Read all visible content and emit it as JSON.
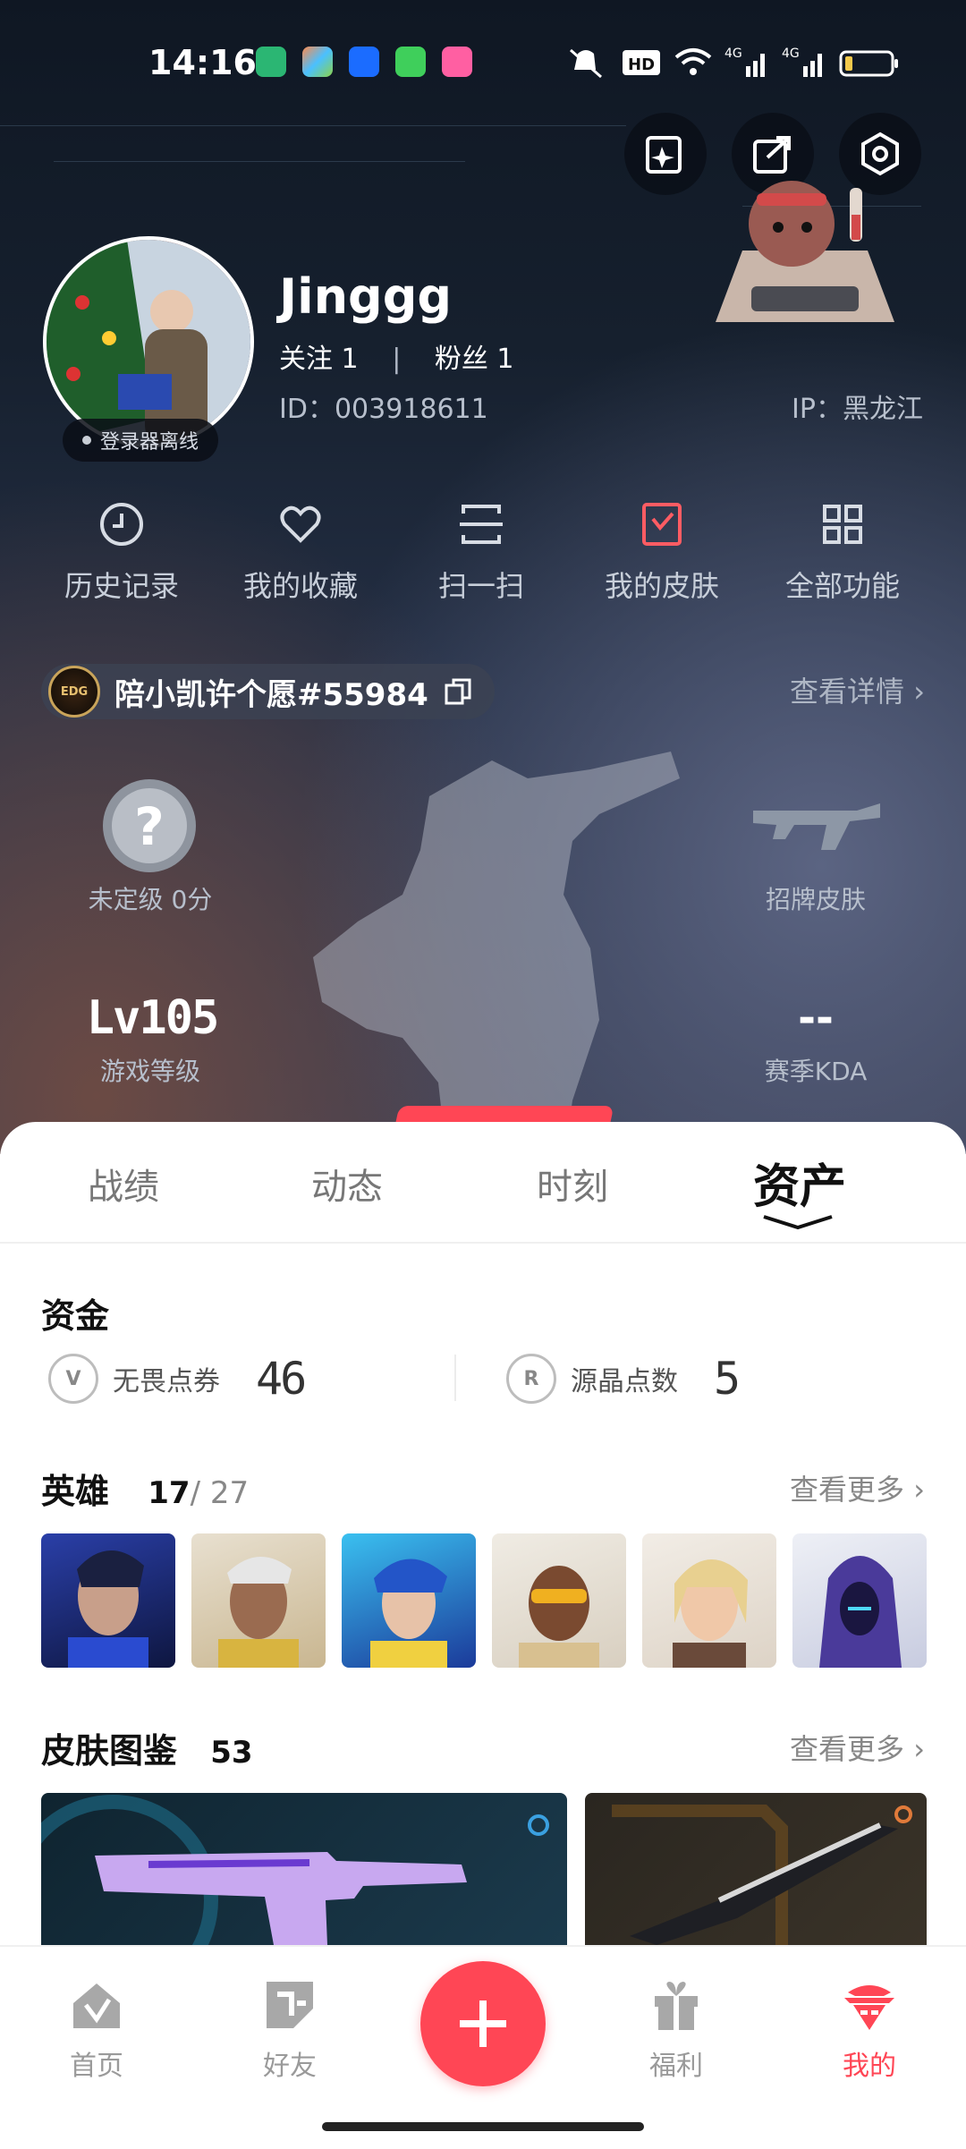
{
  "status_bar": {
    "time": "14:16",
    "battery": ""
  },
  "profile": {
    "username": "Jinggg",
    "follow_label": "关注",
    "follow_count": "1",
    "fans_label": "粉丝",
    "fans_count": "1",
    "id_text": "ID：003918611",
    "ip_text": "IP：黑龙江",
    "offline_label": "登录器离线"
  },
  "functions": [
    {
      "label": "历史记录",
      "icon": "history-icon"
    },
    {
      "label": "我的收藏",
      "icon": "heart-icon"
    },
    {
      "label": "扫一扫",
      "icon": "scan-icon"
    },
    {
      "label": "我的皮肤",
      "icon": "skin-icon"
    },
    {
      "label": "全部功能",
      "icon": "grid-icon"
    }
  ],
  "wish": {
    "text": "陪小凯许个愿#55984",
    "badge": "EDG"
  },
  "view_details": "查看详情",
  "stats": {
    "rank_label": "未定级 0分",
    "signature_skin_label": "招牌皮肤",
    "level_value": "Lv105",
    "level_label": "游戏等级",
    "kda_value": "--",
    "kda_label": "赛季KDA"
  },
  "tabs": [
    {
      "label": "战绩",
      "active": false
    },
    {
      "label": "动态",
      "active": false
    },
    {
      "label": "时刻",
      "active": false
    },
    {
      "label": "资产",
      "active": true
    }
  ],
  "funds": {
    "title": "资金",
    "vp_label": "无畏点券",
    "vp_value": "46",
    "rp_label": "源晶点数",
    "rp_value": "5"
  },
  "heroes": {
    "title": "英雄",
    "owned": "17",
    "total": "/ 27",
    "more": "查看更多"
  },
  "skins": {
    "title": "皮肤图鉴",
    "count": "53",
    "more": "查看更多"
  },
  "nav": [
    {
      "label": "首页",
      "active": false
    },
    {
      "label": "好友",
      "active": false
    },
    {
      "label": "福利",
      "active": false
    },
    {
      "label": "我的",
      "active": true
    }
  ],
  "colors": {
    "accent": "#ff4655",
    "hero_bg": "#16202e"
  }
}
